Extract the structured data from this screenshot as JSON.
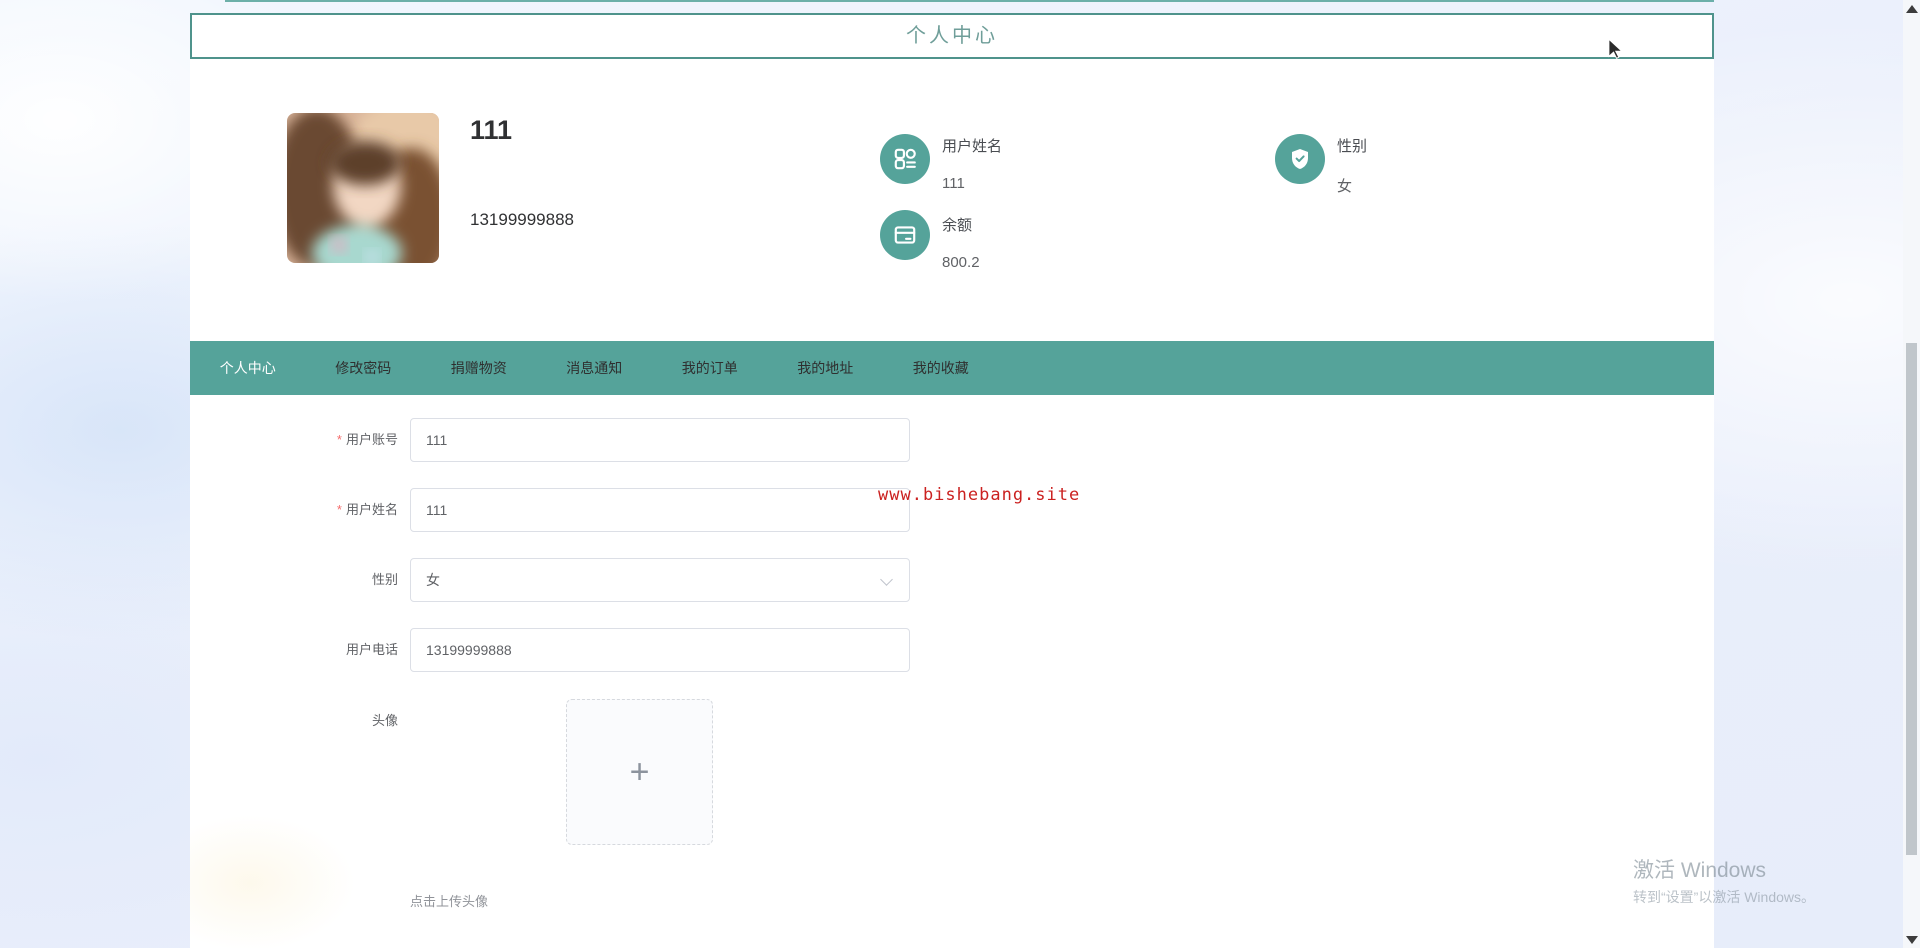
{
  "header": {
    "title": "个人中心"
  },
  "profile": {
    "name": "111",
    "phone": "13199999888",
    "stats": [
      {
        "icon": "grid-icon",
        "label": "用户姓名",
        "value": "111"
      },
      {
        "icon": "wallet-card-icon",
        "label": "余额",
        "value": "800.2"
      },
      {
        "icon": "shield-check-icon",
        "label": "性别",
        "value": "女"
      }
    ]
  },
  "nav": {
    "tabs": [
      {
        "label": "个人中心",
        "active": true
      },
      {
        "label": "修改密码",
        "active": false
      },
      {
        "label": "捐赠物资",
        "active": false
      },
      {
        "label": "消息通知",
        "active": false
      },
      {
        "label": "我的订单",
        "active": false
      },
      {
        "label": "我的地址",
        "active": false
      },
      {
        "label": "我的收藏",
        "active": false
      }
    ]
  },
  "form": {
    "fields": [
      {
        "label": "用户账号",
        "required_mark": "*",
        "value": "111",
        "type": "text"
      },
      {
        "label": "用户姓名",
        "required_mark": "*",
        "value": "111",
        "type": "text"
      },
      {
        "label": "性别",
        "required_mark": "",
        "value": "女",
        "type": "select"
      },
      {
        "label": "用户电话",
        "required_mark": "",
        "value": "13199999888",
        "type": "text"
      },
      {
        "label": "头像",
        "required_mark": "",
        "value": "",
        "type": "upload"
      }
    ],
    "upload_hint": "点击上传头像"
  },
  "icons": {
    "upload_plus": "+"
  },
  "watermark": {
    "text": "www.bishebang.site"
  },
  "windows_watermark": {
    "line1": "激活 Windows",
    "line2": "转到“设置”以激活 Windows。"
  },
  "colors": {
    "teal": "#55a39a",
    "header_border": "#4f938c",
    "required": "#f56c6c",
    "watermark_red": "#cb2120",
    "input_border": "#dcdfe6"
  }
}
